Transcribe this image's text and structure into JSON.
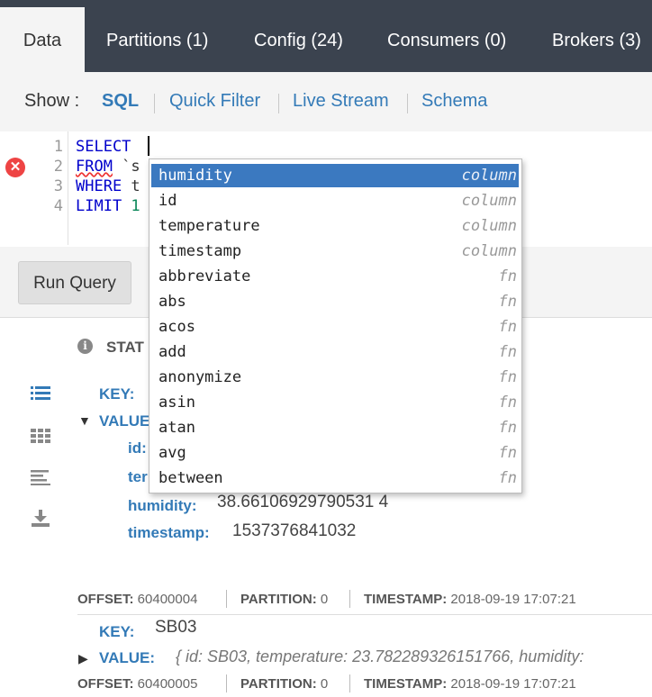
{
  "tabs": [
    {
      "label": "Data"
    },
    {
      "label": "Partitions (1)"
    },
    {
      "label": "Config (24)"
    },
    {
      "label": "Consumers (0)"
    },
    {
      "label": "Brokers (3)"
    }
  ],
  "show": {
    "label": "Show :",
    "options": [
      {
        "label": "SQL"
      },
      {
        "label": "Quick Filter"
      },
      {
        "label": "Live Stream"
      },
      {
        "label": "Schema"
      }
    ]
  },
  "editor": {
    "line_numbers": [
      "1",
      "2",
      "3",
      "4"
    ],
    "lines": [
      {
        "kw": "SELECT",
        "rest": ""
      },
      {
        "kw": "FROM",
        "rest": " `s"
      },
      {
        "kw": "WHERE",
        "rest": " t"
      },
      {
        "kw": "LIMIT",
        "rest": " 1"
      }
    ]
  },
  "run_button": "Run Query",
  "stats_label": "STAT",
  "record1": {
    "key_label": "KEY:",
    "value_label": "VALUE",
    "fields": [
      {
        "label": "id:",
        "value": ""
      },
      {
        "label": "ter",
        "value": ""
      },
      {
        "label": "humidity:",
        "value": "38.66106929790531 4"
      },
      {
        "label": "timestamp:",
        "value": "1537376841032"
      }
    ],
    "offset_label": "OFFSET:",
    "offset": "60400004",
    "partition_label": "PARTITION:",
    "partition": "0",
    "timestamp_label": "TIMESTAMP:",
    "timestamp": "2018-09-19 17:07:21"
  },
  "record2": {
    "key_label": "KEY:",
    "key": "SB03",
    "value_label": "VALUE:",
    "value_preview": "{ id: SB03, temperature: 23.782289326151766, humidity:",
    "offset_label": "OFFSET:",
    "offset": "60400005",
    "partition_label": "PARTITION:",
    "partition": "0",
    "timestamp_label": "TIMESTAMP:",
    "timestamp": "2018-09-19 17:07:21"
  },
  "autocomplete": [
    {
      "name": "humidity",
      "meta": "column"
    },
    {
      "name": "id",
      "meta": "column"
    },
    {
      "name": "temperature",
      "meta": "column"
    },
    {
      "name": "timestamp",
      "meta": "column"
    },
    {
      "name": "abbreviate",
      "meta": "fn"
    },
    {
      "name": "abs",
      "meta": "fn"
    },
    {
      "name": "acos",
      "meta": "fn"
    },
    {
      "name": "add",
      "meta": "fn"
    },
    {
      "name": "anonymize",
      "meta": "fn"
    },
    {
      "name": "asin",
      "meta": "fn"
    },
    {
      "name": "atan",
      "meta": "fn"
    },
    {
      "name": "avg",
      "meta": "fn"
    },
    {
      "name": "between",
      "meta": "fn"
    }
  ],
  "icons": {
    "error": "error-icon",
    "info": "info-icon",
    "list_view": "list-view-icon",
    "grid_view": "grid-view-icon",
    "text_view": "text-view-icon",
    "download": "download-icon"
  },
  "colors": {
    "accent": "#337ab7",
    "topbar": "#3b434f",
    "selection": "#3b79c0"
  }
}
